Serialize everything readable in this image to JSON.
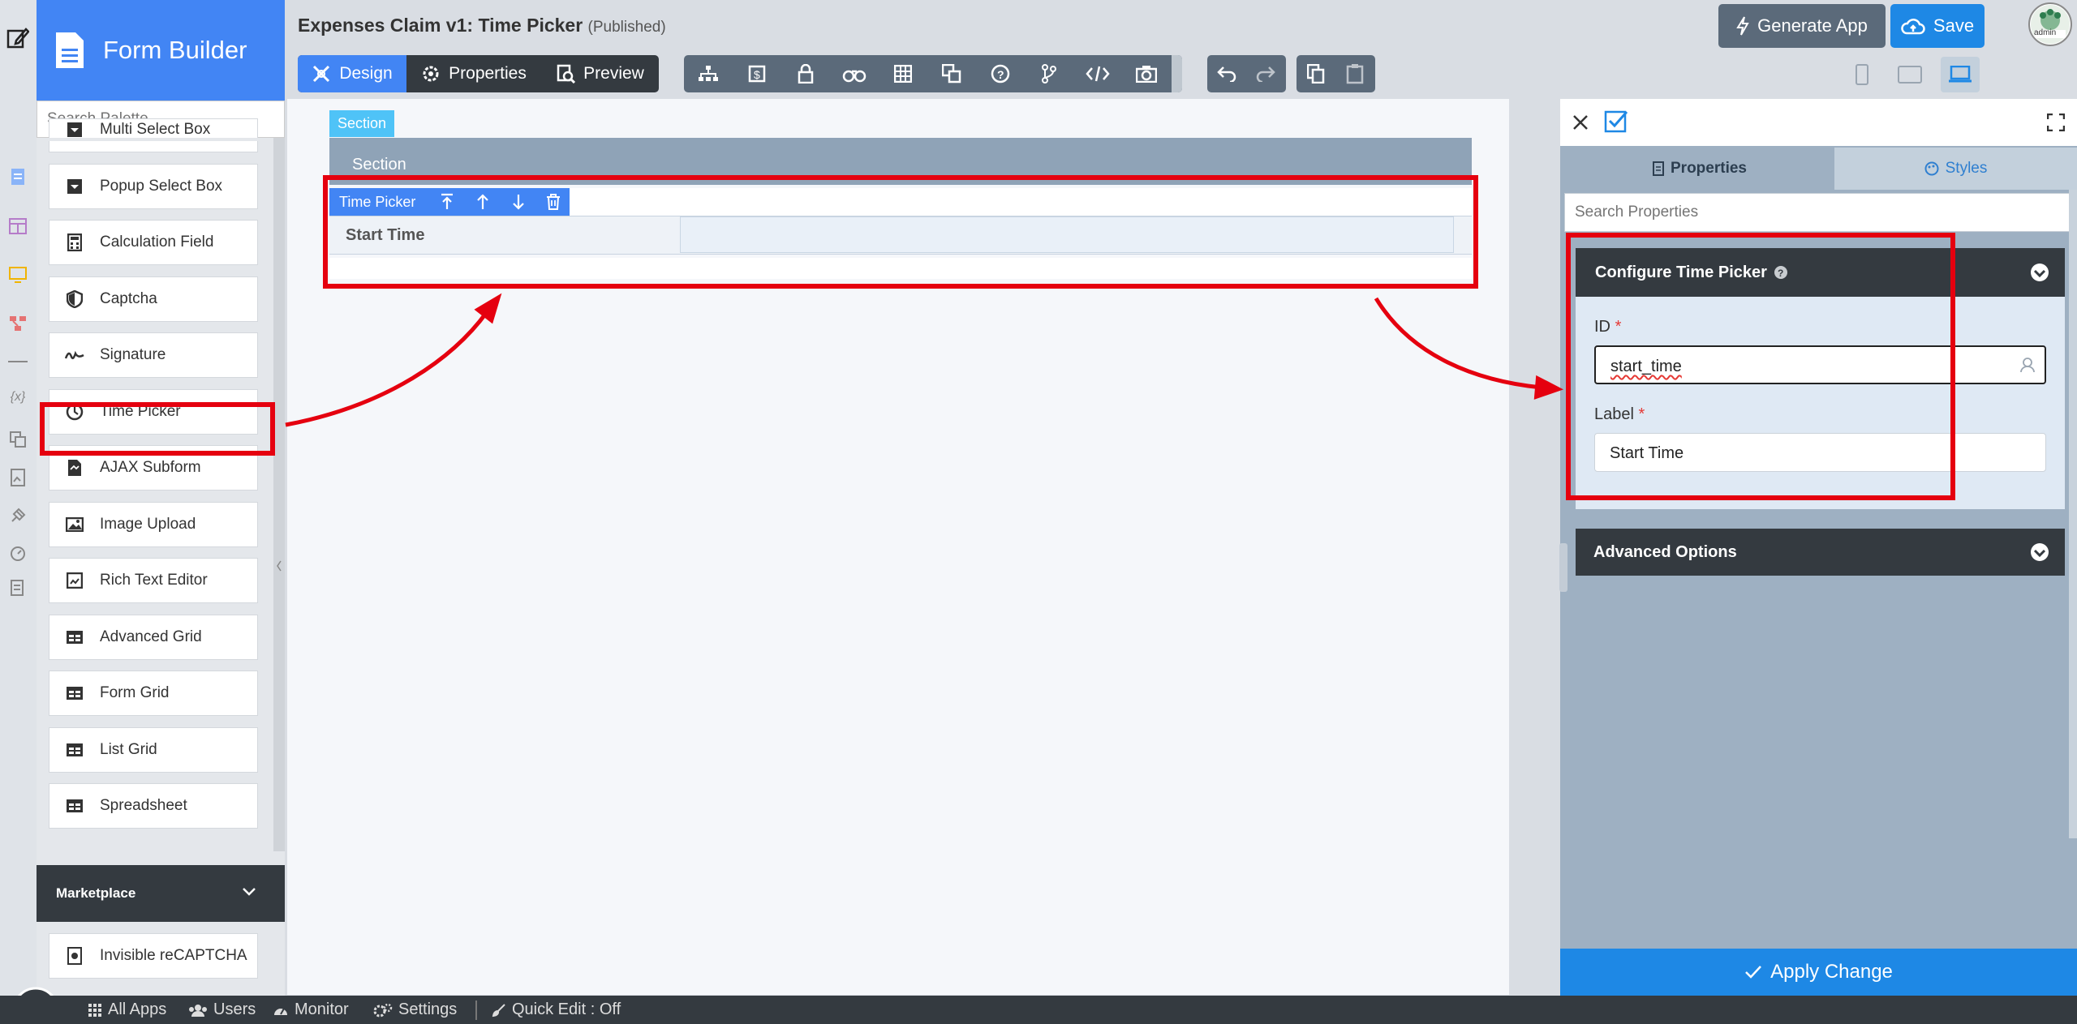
{
  "app": {
    "brand": "Form Builder",
    "form_title": "Expenses Claim v1: Time Picker",
    "form_status": "(Published)"
  },
  "header": {
    "tabs": [
      {
        "label": "Design",
        "icon": "design-icon",
        "active": true
      },
      {
        "label": "Properties",
        "icon": "gear-icon"
      },
      {
        "label": "Preview",
        "icon": "preview-icon"
      }
    ],
    "generate_label": "Generate App",
    "save_label": "Save",
    "avatar_text": "admin"
  },
  "palette": {
    "search_placeholder": "Search Palette",
    "items": [
      {
        "label": "Multi Select Box",
        "icon": "multi-select-icon"
      },
      {
        "label": "Popup Select Box",
        "icon": "popup-select-icon"
      },
      {
        "label": "Calculation Field",
        "icon": "calculator-icon"
      },
      {
        "label": "Captcha",
        "icon": "shield-icon"
      },
      {
        "label": "Signature",
        "icon": "signature-icon"
      },
      {
        "label": "Time Picker",
        "icon": "clock-icon"
      },
      {
        "label": "AJAX Subform",
        "icon": "subform-icon"
      },
      {
        "label": "Image Upload",
        "icon": "image-icon"
      },
      {
        "label": "Rich Text Editor",
        "icon": "rich-text-icon"
      },
      {
        "label": "Advanced Grid",
        "icon": "grid-icon"
      },
      {
        "label": "Form Grid",
        "icon": "grid-icon"
      },
      {
        "label": "List Grid",
        "icon": "grid-icon"
      },
      {
        "label": "Spreadsheet",
        "icon": "grid-icon"
      }
    ],
    "marketplace_label": "Marketplace",
    "marketplace_items": [
      {
        "label": "Invisible reCAPTCHA",
        "icon": "recaptcha-icon"
      }
    ]
  },
  "canvas": {
    "section_tag": "Section",
    "section_header": "Section",
    "field_tag": "Time Picker",
    "field_label": "Start Time"
  },
  "properties_panel": {
    "tab_properties": "Properties",
    "tab_styles": "Styles",
    "search_placeholder": "Search Properties",
    "configure_title": "Configure Time Picker",
    "id_label": "ID",
    "id_value": "start_time",
    "label_label": "Label",
    "label_value": "Start Time",
    "required_mark": "*",
    "advanced_title": "Advanced Options",
    "apply_label": "Apply Change"
  },
  "bottom_bar": {
    "all_apps": "All Apps",
    "users": "Users",
    "monitor": "Monitor",
    "settings": "Settings",
    "quick_edit": "Quick Edit : Off"
  },
  "colors": {
    "primary_blue": "#4285f4",
    "save_blue": "#1e88e5",
    "dark_header": "#343a40",
    "toolbar_gray": "#5b6a7a",
    "annotation_red": "#e5000f",
    "section_tag": "#4fc3f7"
  }
}
